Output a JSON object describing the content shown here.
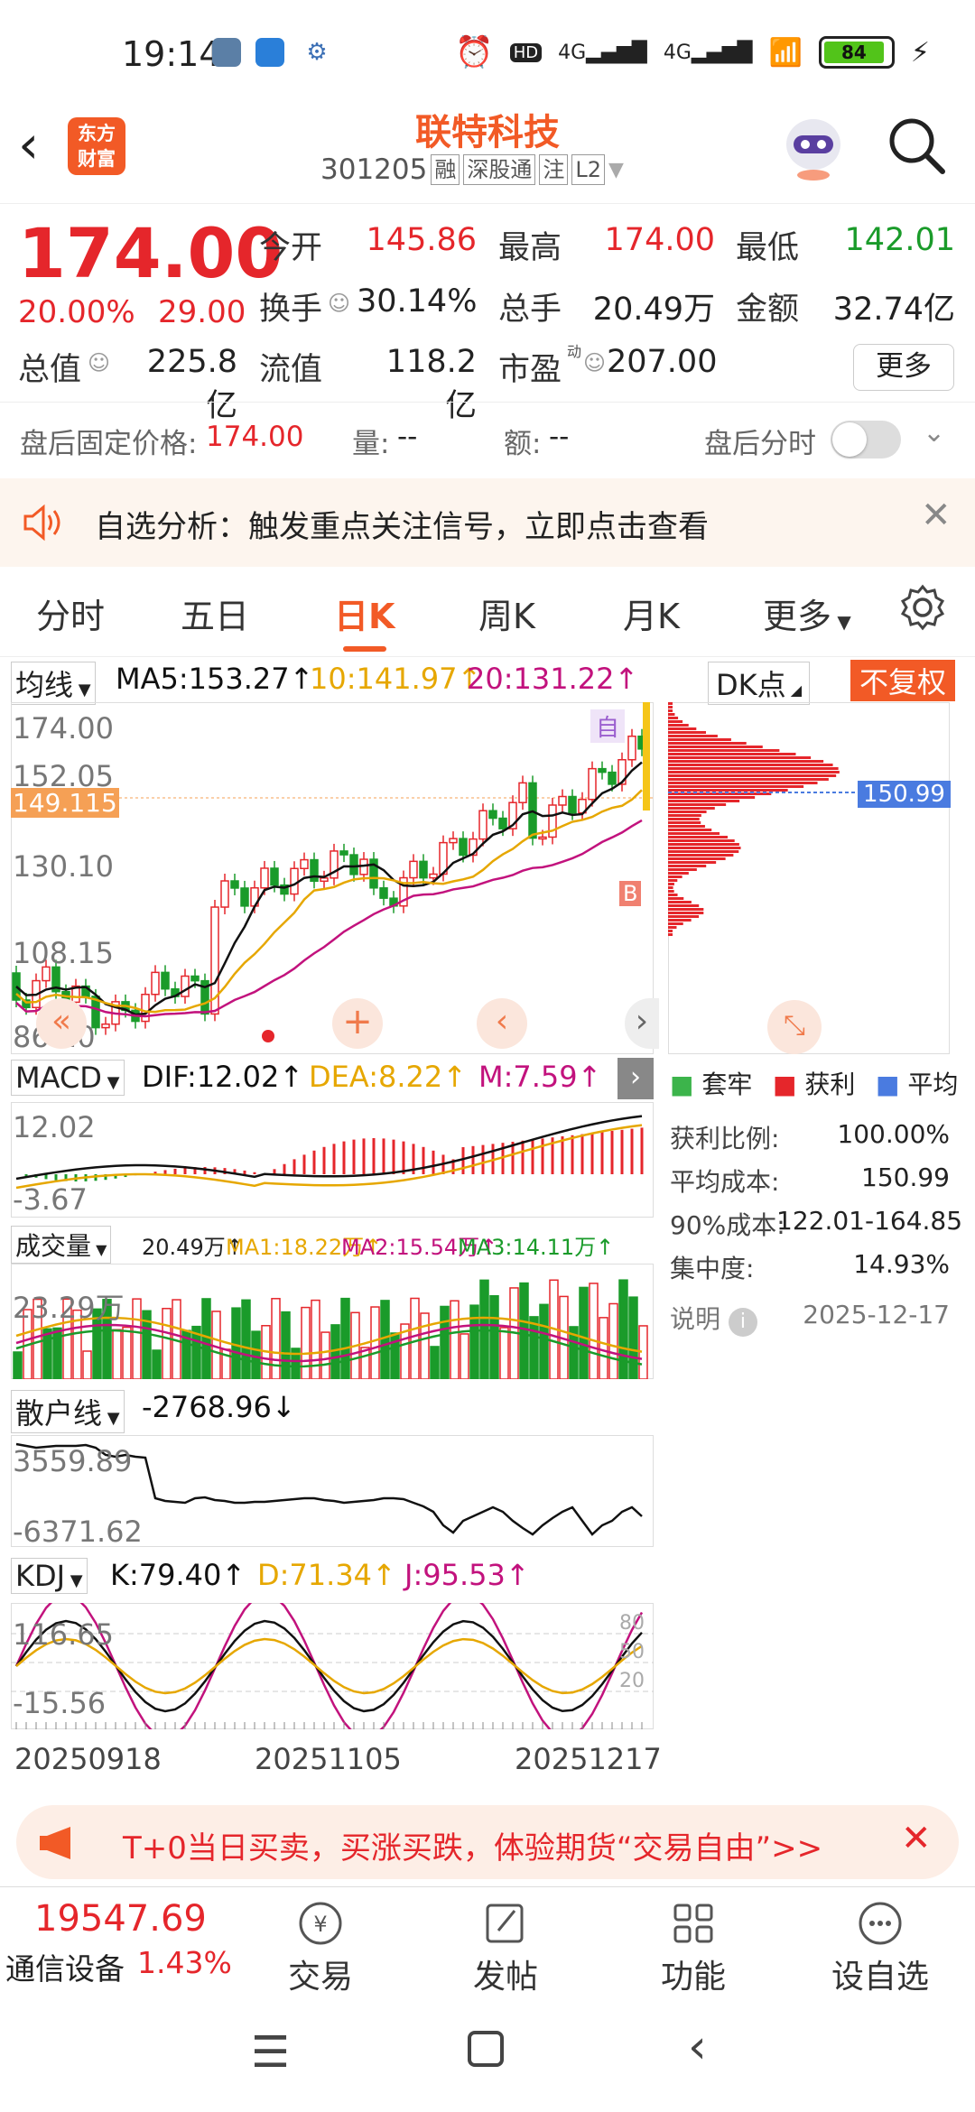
{
  "status": {
    "time": "19:14",
    "battery": "84"
  },
  "header": {
    "logo": "东方\n财富",
    "name": "联特科技",
    "code": "301205",
    "tags": [
      "融",
      "深股通",
      "注",
      "L2"
    ]
  },
  "quote": {
    "price": "174.00",
    "chg_pct": "20.00%",
    "chg": "29.00",
    "open_label": "今开",
    "open": "145.86",
    "high_label": "最高",
    "high": "174.00",
    "low_label": "最低",
    "low": "142.01",
    "turnover_label": "换手",
    "turnover": "30.14%",
    "volume_label": "总手",
    "volume": "20.49万",
    "amount_label": "金额",
    "amount": "32.74亿",
    "mktcap_label": "总值",
    "mktcap": "225.8亿",
    "float_label": "流值",
    "float": "118.2亿",
    "pe_label": "市盈",
    "pe_sup": "动",
    "pe": "207.00",
    "more": "更多"
  },
  "after_hours": {
    "label": "盘后固定价格:",
    "price": "174.00",
    "vol_label": "量:",
    "vol": "--",
    "amt_label": "额:",
    "amt": "--",
    "intraday_label": "盘后分时"
  },
  "notice": {
    "text": "自选分析：触发重点关注信号，立即点击查看"
  },
  "tabs": [
    "分时",
    "五日",
    "日K",
    "周K",
    "月K",
    "更多"
  ],
  "ma": {
    "selector": "均线",
    "ma5": "MA5:153.27↑",
    "ma10": "10:141.97↑",
    "ma20": "20:131.22↑"
  },
  "chip": {
    "selector": "DK点",
    "adjust": "不复权",
    "price_marker": "150.99",
    "legend": [
      "套牢",
      "获利",
      "平均"
    ],
    "stats": [
      {
        "label": "获利比例:",
        "value": "100.00%"
      },
      {
        "label": "平均成本:",
        "value": "150.99"
      },
      {
        "label": "90%成本:",
        "value": "122.01-164.85"
      },
      {
        "label": "集中度:",
        "value": "14.93%"
      }
    ],
    "explain": "说明",
    "date": "2025-12-17"
  },
  "kline": {
    "y_labels": [
      "174.00",
      "152.05",
      "130.10",
      "108.15",
      "86.20"
    ],
    "cursor_price": "149.115",
    "mark_self": "自",
    "mark_b": "B"
  },
  "macd": {
    "selector": "MACD",
    "dif": "DIF:12.02↑",
    "dea": "DEA:8.22↑",
    "m": "M:7.59↑",
    "y_top": "12.02",
    "y_bot": "-3.67"
  },
  "vol": {
    "selector": "成交量",
    "v": "20.49万↑",
    "ma1": "MA1:18.22万↑",
    "ma2": "MA2:15.54万↑",
    "ma3": "MA3:14.11万↑",
    "y_top": "23.29万"
  },
  "retail": {
    "selector": "散户线",
    "value": "-2768.96↓",
    "y_top": "3559.89",
    "y_bot": "-6371.62"
  },
  "kdj": {
    "selector": "KDJ",
    "k": "K:79.40↑",
    "d": "D:71.34↑",
    "j": "J:95.53↑",
    "y_top": "116.65",
    "y_bot": "-15.56",
    "levels": [
      "80",
      "50",
      "20"
    ]
  },
  "dates": [
    "20250918",
    "20251105",
    "20251217"
  ],
  "promo": {
    "text": "T+0当日买卖，买涨买跌，体验期货“交易自由”>>"
  },
  "bottom": {
    "index_value": "19547.69",
    "sector": "通信设备",
    "sector_chg": "1.43%",
    "nav": [
      "交易",
      "发帖",
      "功能",
      "设自选"
    ]
  }
}
